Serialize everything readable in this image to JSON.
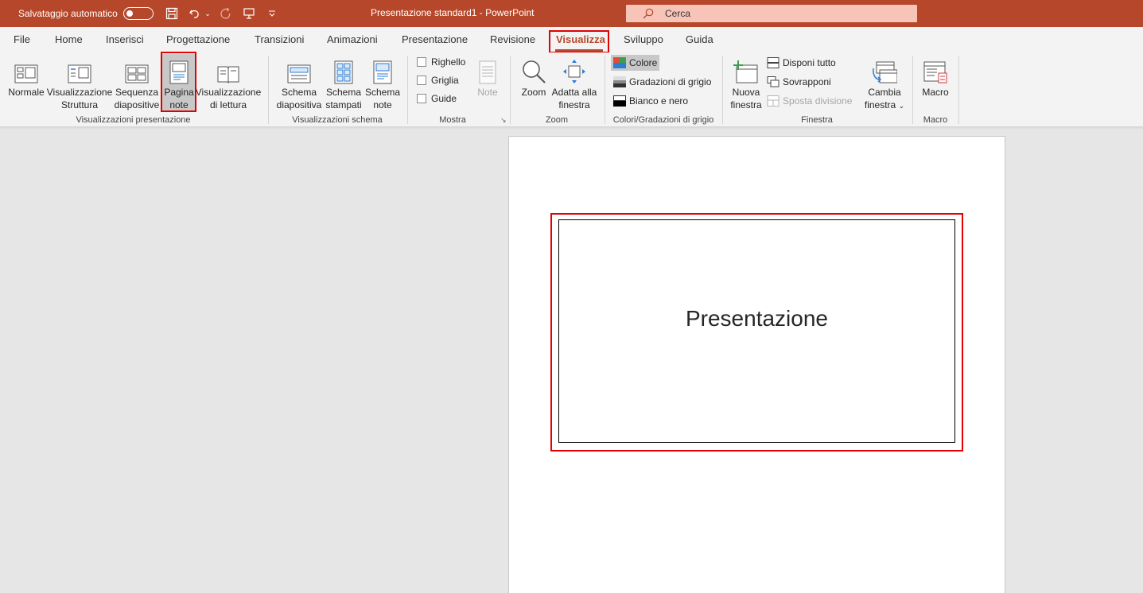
{
  "titlebar": {
    "autosave_label": "Salvataggio automatico",
    "doc_title": "Presentazione standard1  -  PowerPoint",
    "search_placeholder": "Cerca"
  },
  "tabs": [
    {
      "label": "File"
    },
    {
      "label": "Home"
    },
    {
      "label": "Inserisci"
    },
    {
      "label": "Progettazione"
    },
    {
      "label": "Transizioni"
    },
    {
      "label": "Animazioni"
    },
    {
      "label": "Presentazione"
    },
    {
      "label": "Revisione"
    },
    {
      "label": "Visualizza",
      "active": true
    },
    {
      "label": "Sviluppo"
    },
    {
      "label": "Guida"
    }
  ],
  "ribbon": {
    "presentation_views": {
      "label": "Visualizzazioni presentazione",
      "normale": "Normale",
      "struttura_1": "Visualizzazione",
      "struttura_2": "Struttura",
      "sequenza_1": "Sequenza",
      "sequenza_2": "diapositive",
      "pagina_1": "Pagina",
      "pagina_2": "note",
      "lettura_1": "Visualizzazione",
      "lettura_2": "di lettura"
    },
    "master_views": {
      "label": "Visualizzazioni schema",
      "diapositiva_1": "Schema",
      "diapositiva_2": "diapositiva",
      "stampati_1": "Schema",
      "stampati_2": "stampati",
      "note_1": "Schema",
      "note_2": "note"
    },
    "show": {
      "label": "Mostra",
      "righello": "Righello",
      "griglia": "Griglia",
      "guide": "Guide",
      "note": "Note"
    },
    "zoom": {
      "label": "Zoom",
      "zoom": "Zoom",
      "fit_1": "Adatta alla",
      "fit_2": "finestra"
    },
    "color": {
      "label": "Colori/Gradazioni di grigio",
      "colore": "Colore",
      "grigio": "Gradazioni di grigio",
      "bn": "Bianco e nero"
    },
    "window": {
      "label": "Finestra",
      "nuova_1": "Nuova",
      "nuova_2": "finestra",
      "disponi": "Disponi tutto",
      "sovrapponi": "Sovrapponi",
      "sposta": "Sposta divisione",
      "cambia_1": "Cambia",
      "cambia_2": "finestra"
    },
    "macro": {
      "label": "Macro",
      "macro": "Macro"
    }
  },
  "slide": {
    "title": "Presentazione"
  }
}
